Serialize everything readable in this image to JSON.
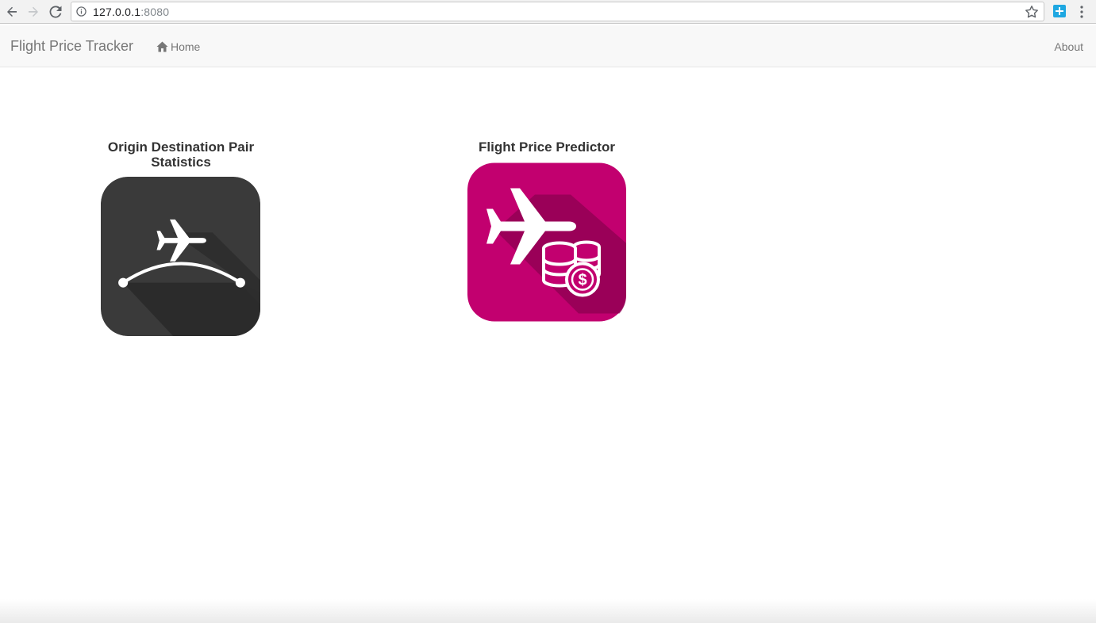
{
  "browser": {
    "url_host": "127.0.0.1",
    "url_port": ":8080"
  },
  "navbar": {
    "brand": "Flight Price Tracker",
    "home_label": "Home",
    "about_label": "About"
  },
  "tiles": [
    {
      "title": "Origin Destination Pair Statistics",
      "color": "#3a3a3a",
      "icon": "flight-route-icon"
    },
    {
      "title": "Flight Price Predictor",
      "color": "#c2006f",
      "icon": "flight-price-icon"
    }
  ]
}
